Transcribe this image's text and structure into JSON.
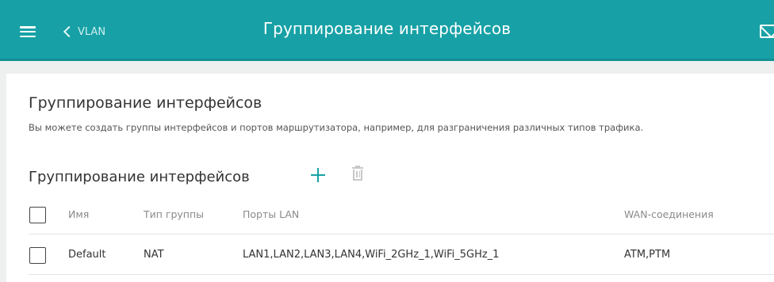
{
  "header": {
    "back_label": "VLAN",
    "title": "Группирование интерфейсов"
  },
  "main": {
    "section_title": "Группирование интерфейсов",
    "description": "Вы можете создать группы интерфейсов и портов маршрутизатора, например, для разграничения различных типов трафика.",
    "group_title": "Группирование интерфейсов",
    "table": {
      "columns": [
        "Имя",
        "Тип группы",
        "Порты LAN",
        "WAN-соединения"
      ],
      "rows": [
        {
          "name": "Default",
          "type": "NAT",
          "lan_ports": "LAN1,LAN2,LAN3,LAN4,WiFi_2GHz_1,WiFi_5GHz_1",
          "wan": "ATM,PTM"
        }
      ]
    }
  },
  "colors": {
    "accent": "#17a1a6",
    "background": "#eef0f0"
  },
  "icons": [
    "menu-icon",
    "chevron-left-icon",
    "mail-icon",
    "add-icon",
    "trash-icon"
  ]
}
